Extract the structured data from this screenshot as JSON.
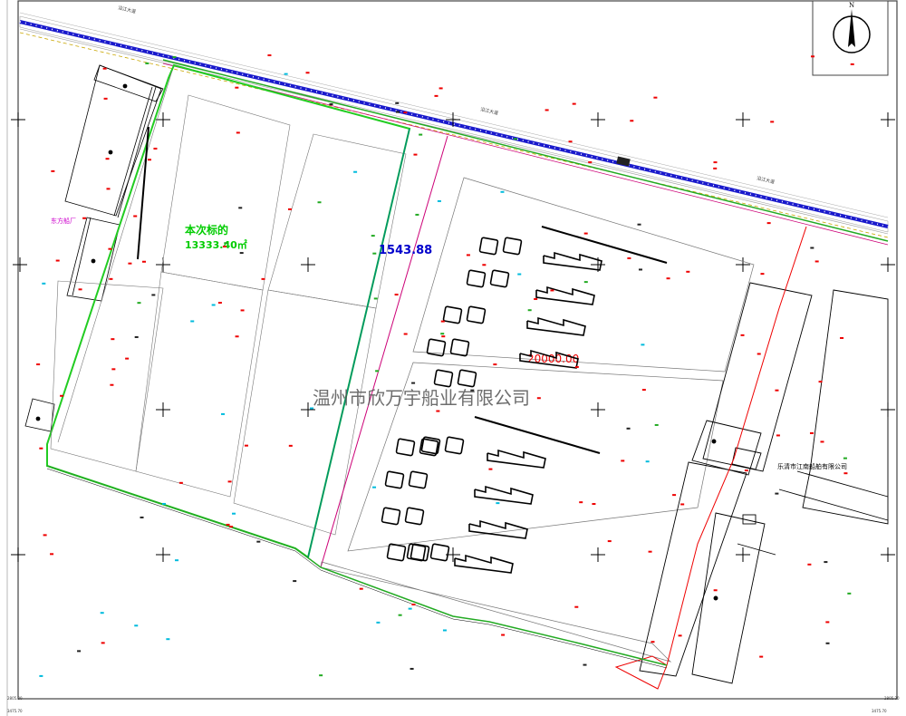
{
  "plot": {
    "label_bid": "本次标的",
    "area_bid": "13333.40㎡",
    "boundary_length": "1543.88",
    "area_adjacent": "20000.00",
    "owner": "温州市欣万宇船业有限公司",
    "neighbor_west": "东方船厂",
    "neighbor_east": "乐清市江南船舶有限公司"
  },
  "road": {
    "label_a": "沿江大道",
    "label_b": "沿江大道",
    "label_c": "沿江大道"
  },
  "compass": {
    "north_letter": "N"
  },
  "frame": {
    "coord_bl": "2805.20",
    "coord_br": "2805.20",
    "coord_bl2": "3475.70",
    "coord_br2": "3475.70"
  },
  "colors": {
    "bid_boundary": "#22cc22",
    "teal_line": "#009070",
    "magenta_line": "#cc0077",
    "red_line": "#ee0000",
    "road_blue": "#0000cc",
    "watermark": "#555555"
  }
}
